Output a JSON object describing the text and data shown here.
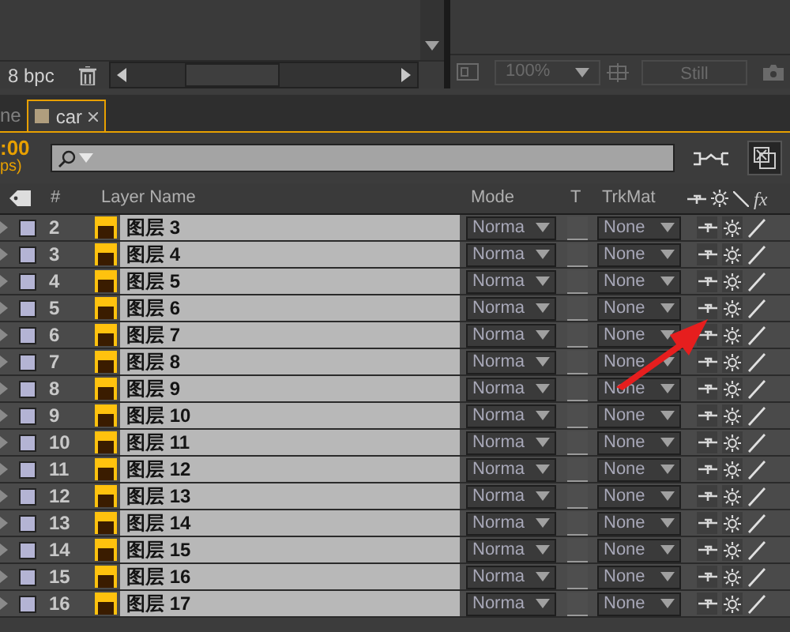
{
  "project_panel": {
    "bit_depth": "8 bpc"
  },
  "viewer_toolbar": {
    "zoom": "100%",
    "still_button": "Still"
  },
  "tabs": [
    {
      "label": "ne",
      "selected": false
    },
    {
      "label": "car",
      "selected": true,
      "color": "#b09e7e"
    }
  ],
  "timecode": {
    "time": ":00",
    "fps": "ps)"
  },
  "columns": {
    "number": "#",
    "name": "Layer Name",
    "mode": "Mode",
    "t": "T",
    "trkmat": "TrkMat",
    "fx": "fx"
  },
  "layers": [
    {
      "number": "2",
      "name": "图层 3",
      "color": "#b4b4d4",
      "mode": "Norma",
      "preserve_transparency": false,
      "trkmat": "None",
      "shy": false,
      "collapse": false
    },
    {
      "number": "3",
      "name": "图层 4",
      "color": "#b4b4d4",
      "mode": "Norma",
      "preserve_transparency": false,
      "trkmat": "None",
      "shy": false,
      "collapse": false
    },
    {
      "number": "4",
      "name": "图层 5",
      "color": "#b4b4d4",
      "mode": "Norma",
      "preserve_transparency": false,
      "trkmat": "None",
      "shy": false,
      "collapse": false
    },
    {
      "number": "5",
      "name": "图层 6",
      "color": "#b4b4d4",
      "mode": "Norma",
      "preserve_transparency": false,
      "trkmat": "None",
      "shy": false,
      "collapse": false
    },
    {
      "number": "6",
      "name": "图层 7",
      "color": "#b4b4d4",
      "mode": "Norma",
      "preserve_transparency": false,
      "trkmat": "None",
      "shy": false,
      "collapse": false
    },
    {
      "number": "7",
      "name": "图层 8",
      "color": "#b4b4d4",
      "mode": "Norma",
      "preserve_transparency": false,
      "trkmat": "None",
      "shy": false,
      "collapse": false
    },
    {
      "number": "8",
      "name": "图层 9",
      "color": "#b4b4d4",
      "mode": "Norma",
      "preserve_transparency": false,
      "trkmat": "None",
      "shy": false,
      "collapse": false
    },
    {
      "number": "9",
      "name": "图层 10",
      "color": "#b4b4d4",
      "mode": "Norma",
      "preserve_transparency": false,
      "trkmat": "None",
      "shy": false,
      "collapse": false
    },
    {
      "number": "10",
      "name": "图层 11",
      "color": "#b4b4d4",
      "mode": "Norma",
      "preserve_transparency": false,
      "trkmat": "None",
      "shy": false,
      "collapse": false
    },
    {
      "number": "11",
      "name": "图层 12",
      "color": "#b4b4d4",
      "mode": "Norma",
      "preserve_transparency": false,
      "trkmat": "None",
      "shy": false,
      "collapse": false
    },
    {
      "number": "12",
      "name": "图层 13",
      "color": "#b4b4d4",
      "mode": "Norma",
      "preserve_transparency": false,
      "trkmat": "None",
      "shy": false,
      "collapse": false
    },
    {
      "number": "13",
      "name": "图层 14",
      "color": "#b4b4d4",
      "mode": "Norma",
      "preserve_transparency": false,
      "trkmat": "None",
      "shy": false,
      "collapse": false
    },
    {
      "number": "14",
      "name": "图层 15",
      "color": "#b4b4d4",
      "mode": "Norma",
      "preserve_transparency": false,
      "trkmat": "None",
      "shy": false,
      "collapse": false
    },
    {
      "number": "15",
      "name": "图层 16",
      "color": "#b4b4d4",
      "mode": "Norma",
      "preserve_transparency": false,
      "trkmat": "None",
      "shy": false,
      "collapse": false
    },
    {
      "number": "16",
      "name": "图层 17",
      "color": "#b4b4d4",
      "mode": "Norma",
      "preserve_transparency": false,
      "trkmat": "None",
      "shy": false,
      "collapse": false
    }
  ]
}
